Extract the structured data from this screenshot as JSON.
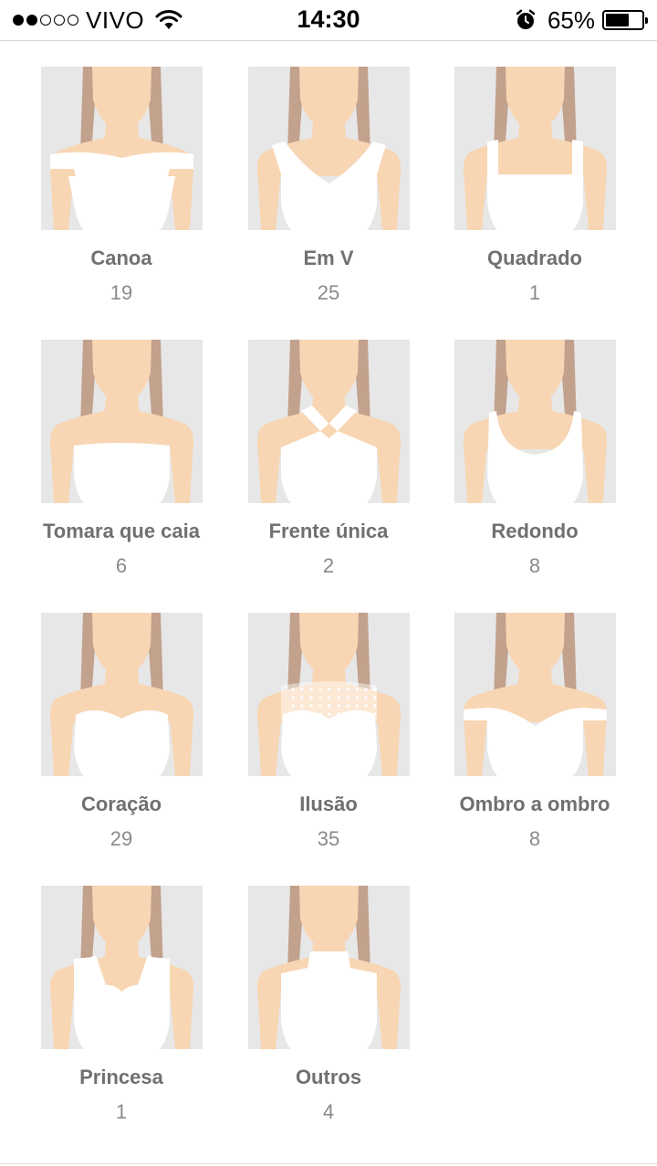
{
  "status_bar": {
    "carrier": "VIVO",
    "time": "14:30",
    "battery": "65%",
    "battery_level": 0.65,
    "signal_dots_filled": 2,
    "signal_dots_total": 5,
    "icons": [
      "wifi-icon",
      "alarm-icon",
      "battery-icon"
    ]
  },
  "colors": {
    "thumb_bg": "#e7e7e8",
    "skin": "#f8d6b3",
    "hair": "#c2a18d",
    "dress": "#ffffff",
    "label": "#707070",
    "count": "#8a8a8a"
  },
  "necklines": [
    {
      "label": "Canoa",
      "count": "19",
      "style": "canoa"
    },
    {
      "label": "Em V",
      "count": "25",
      "style": "em-v"
    },
    {
      "label": "Quadrado",
      "count": "1",
      "style": "quadrado"
    },
    {
      "label": "Tomara que caia",
      "count": "6",
      "style": "tomara-que-caia"
    },
    {
      "label": "Frente única",
      "count": "2",
      "style": "frente-unica"
    },
    {
      "label": "Redondo",
      "count": "8",
      "style": "redondo"
    },
    {
      "label": "Coração",
      "count": "29",
      "style": "coracao"
    },
    {
      "label": "Ilusão",
      "count": "35",
      "style": "ilusao"
    },
    {
      "label": "Ombro a ombro",
      "count": "8",
      "style": "ombro-a-ombro"
    },
    {
      "label": "Princesa",
      "count": "1",
      "style": "princesa"
    },
    {
      "label": "Outros",
      "count": "4",
      "style": "outros"
    }
  ]
}
